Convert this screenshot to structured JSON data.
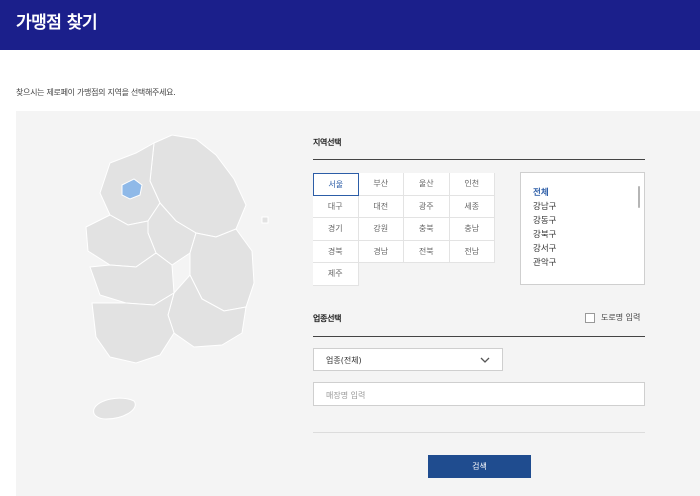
{
  "header": {
    "title": "가맹점 찾기",
    "bg_color": "#1b1f8b"
  },
  "guide_text": "찾으시는 제로페이 가맹점의 지역을 선택해주세요.",
  "map": {
    "selected_region": "서울",
    "highlight_color": "#8fb9e8",
    "land_color": "#e2e2e2"
  },
  "region_section": {
    "label": "지역선택",
    "regions": [
      {
        "label": "서울",
        "selected": true
      },
      {
        "label": "부산",
        "selected": false
      },
      {
        "label": "울산",
        "selected": false
      },
      {
        "label": "인천",
        "selected": false
      },
      {
        "label": "대구",
        "selected": false
      },
      {
        "label": "대전",
        "selected": false
      },
      {
        "label": "광주",
        "selected": false
      },
      {
        "label": "세종",
        "selected": false
      },
      {
        "label": "경기",
        "selected": false
      },
      {
        "label": "강원",
        "selected": false
      },
      {
        "label": "충북",
        "selected": false
      },
      {
        "label": "충남",
        "selected": false
      },
      {
        "label": "경북",
        "selected": false
      },
      {
        "label": "경남",
        "selected": false
      },
      {
        "label": "전북",
        "selected": false
      },
      {
        "label": "전남",
        "selected": false
      },
      {
        "label": "제주",
        "selected": false
      }
    ],
    "districts": [
      {
        "label": "전체",
        "active": true
      },
      {
        "label": "강남구",
        "active": false
      },
      {
        "label": "강동구",
        "active": false
      },
      {
        "label": "강북구",
        "active": false
      },
      {
        "label": "강서구",
        "active": false
      },
      {
        "label": "관악구",
        "active": false
      }
    ]
  },
  "business_section": {
    "label": "업종선택",
    "road_address_label": "도로명 입력",
    "category_value": "업종(전체)",
    "store_placeholder": "매장명 입력"
  },
  "search_button_label": "검색",
  "colors": {
    "accent": "#2c5da7",
    "button": "#1f4c8f",
    "panel": "#f4f4f4"
  }
}
